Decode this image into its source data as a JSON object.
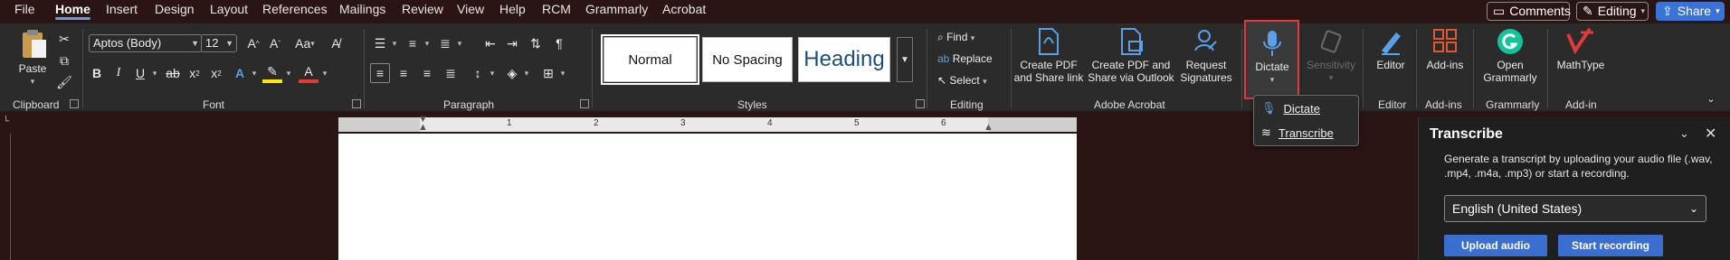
{
  "tabs": [
    "File",
    "Home",
    "Insert",
    "Design",
    "Layout",
    "References",
    "Mailings",
    "Review",
    "View",
    "Help",
    "RCM",
    "Grammarly",
    "Acrobat"
  ],
  "active_tab": "Home",
  "topright": {
    "comments": "Comments",
    "editing": "Editing",
    "share": "Share"
  },
  "clipboard": {
    "paste": "Paste",
    "label": "Clipboard"
  },
  "font": {
    "family": "Aptos (Body)",
    "size": "12",
    "label": "Font"
  },
  "paragraph": {
    "label": "Paragraph"
  },
  "styles": {
    "items": [
      "Normal",
      "No Spacing",
      "Heading"
    ],
    "label": "Styles"
  },
  "editing_grp": {
    "find": "Find",
    "replace": "Replace",
    "select": "Select",
    "label": "Editing"
  },
  "acrobat": {
    "b1": [
      "Create PDF",
      "and Share link"
    ],
    "b2": [
      "Create PDF and",
      "Share via Outlook"
    ],
    "b3": [
      "Request",
      "Signatures"
    ],
    "label": "Adobe Acrobat"
  },
  "dictate": {
    "label": "Dictate"
  },
  "sensitivity": {
    "label": "Sensitivity"
  },
  "editor": {
    "label": "Editor",
    "group": "Editor"
  },
  "addins": {
    "label": "Add-ins",
    "group": "Add-ins"
  },
  "grammarly": {
    "b1": "Open",
    "b2": "Grammarly",
    "group": "Grammarly"
  },
  "mathtype": {
    "label": "MathType",
    "group": "Add-in"
  },
  "menu": {
    "items": [
      "Dictate",
      "Transcribe"
    ]
  },
  "pane": {
    "title": "Transcribe",
    "desc": "Generate a transcript by uploading your audio file (.wav, .mp4, .m4a, .mp3) or start a recording.",
    "language": "English (United States)",
    "upload": "Upload audio",
    "record": "Start recording"
  },
  "ruler_numbers": [
    "1",
    "2",
    "3",
    "4",
    "5",
    "6"
  ],
  "colors": {
    "accent": "#3a73d8",
    "highlight_box": "#e0393e",
    "bg": "#2b1414"
  }
}
